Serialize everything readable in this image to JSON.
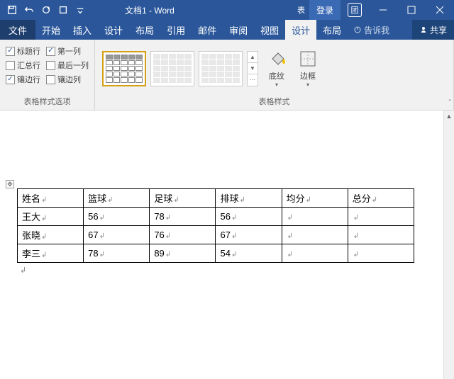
{
  "title": "文档1 - Word",
  "login": "登录",
  "menu": {
    "file": "文件",
    "home": "开始",
    "insert": "插入",
    "design": "设计",
    "layout": "布局",
    "references": "引用",
    "mailings": "邮件",
    "review": "审阅",
    "view": "视图",
    "table_design": "设计",
    "table_layout": "布局",
    "tell_me": "告诉我",
    "share": "共享"
  },
  "ribbon": {
    "options_label": "表格样式选项",
    "styles_label": "表格样式",
    "shading": "底纹",
    "borders": "边框",
    "opts": {
      "header_row": "标题行",
      "first_col": "第一列",
      "total_row": "汇总行",
      "last_col": "最后一列",
      "banded_rows": "镶边行",
      "banded_cols": "镶边列"
    }
  },
  "table": {
    "headers": [
      "姓名",
      "篮球",
      "足球",
      "排球",
      "均分",
      "总分"
    ],
    "rows": [
      {
        "name": "王大",
        "c1": "56",
        "c2": "78",
        "c3": "56",
        "c4": "",
        "c5": ""
      },
      {
        "name": "张晓",
        "c1": "67",
        "c2": "76",
        "c3": "67",
        "c4": "",
        "c5": ""
      },
      {
        "name": "李三",
        "c1": "78",
        "c2": "89",
        "c3": "54",
        "c4": "",
        "c5": ""
      }
    ]
  },
  "chart_data": {
    "type": "table",
    "columns": [
      "姓名",
      "篮球",
      "足球",
      "排球",
      "均分",
      "总分"
    ],
    "rows": [
      [
        "王大",
        56,
        78,
        56,
        null,
        null
      ],
      [
        "张晓",
        67,
        76,
        67,
        null,
        null
      ],
      [
        "李三",
        78,
        89,
        54,
        null,
        null
      ]
    ]
  }
}
